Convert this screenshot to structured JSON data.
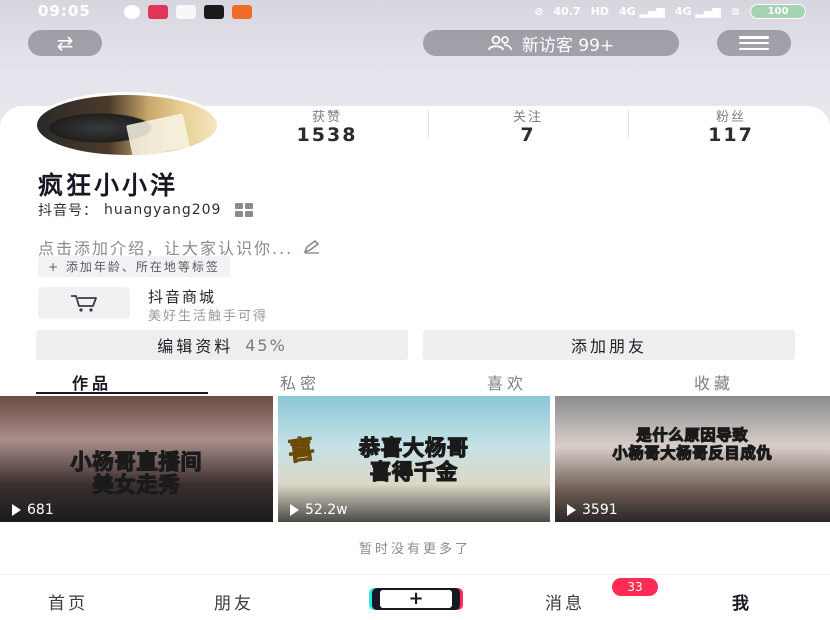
{
  "status_bar": {
    "time": "09:05",
    "network_speed": "40.7",
    "battery_level": "100"
  },
  "top_nav": {
    "visitors_label": "新访客 99+"
  },
  "profile": {
    "stats": [
      {
        "label": "获赞",
        "value": "1538"
      },
      {
        "label": "关注",
        "value": "7"
      },
      {
        "label": "粉丝",
        "value": "117"
      }
    ],
    "nickname": "疯狂小小洋",
    "account_label": "抖音号：",
    "account_id": "huangyang209",
    "intro_prompt": "点击添加介绍，让大家认识你...",
    "add_tags": "+ 添加年龄、所在地等标签"
  },
  "mall": {
    "title": "抖音商城",
    "subtitle": "美好生活触手可得"
  },
  "actions": {
    "edit_label": "编辑资料",
    "edit_progress": "45%",
    "add_friend_label": "添加朋友"
  },
  "tabs": [
    {
      "label": "作品",
      "active": true
    },
    {
      "label": "私密",
      "active": false
    },
    {
      "label": "喜欢",
      "active": false
    },
    {
      "label": "收藏",
      "active": false
    }
  ],
  "videos": [
    {
      "caption_line1": "小杨哥直播间",
      "caption_line2": "美女走秀",
      "plays": "681"
    },
    {
      "banner": "喜",
      "caption_line1": "恭喜大杨哥",
      "caption_line2": "喜得千金",
      "plays": "52.2w"
    },
    {
      "caption_line1": "是什么原因导致",
      "caption_line2": "小杨哥大杨哥反目成仇",
      "plays": "3591"
    }
  ],
  "no_more_text": "暂时没有更多了",
  "bottom_nav": {
    "home": "首页",
    "friends": "朋友",
    "plus": "+",
    "messages": "消息",
    "messages_badge": "33",
    "me": "我"
  },
  "colors": {
    "badge": "#fe2c55",
    "caption": "#ffe64a",
    "text_primary": "#161823"
  }
}
